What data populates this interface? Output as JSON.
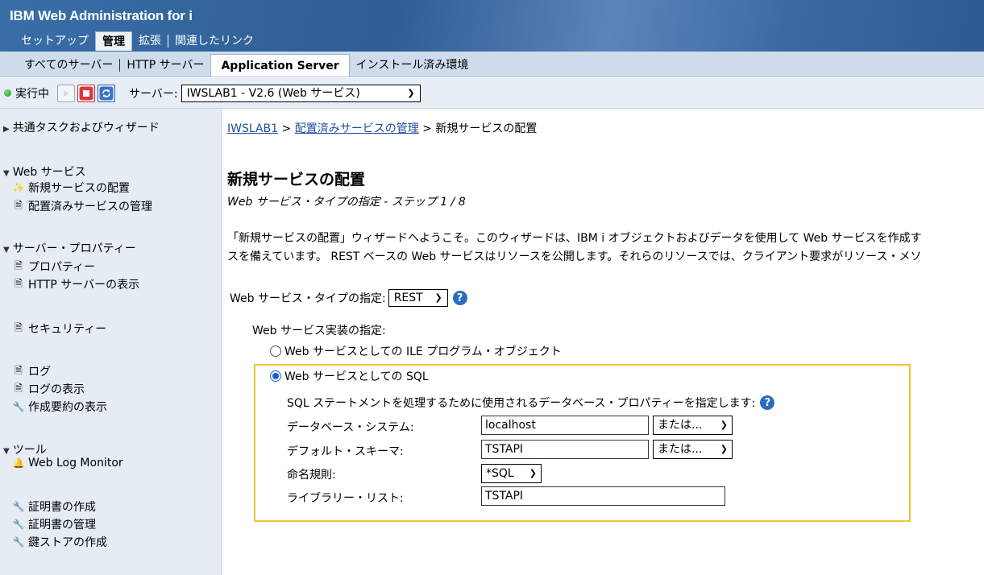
{
  "app": {
    "title": "IBM Web Administration for i"
  },
  "main_tabs": [
    {
      "label": "セットアップ"
    },
    {
      "label": "管理"
    },
    {
      "label": "拡張"
    },
    {
      "label": "関連したリンク"
    }
  ],
  "sub_tabs": [
    {
      "label": "すべてのサーバー"
    },
    {
      "label": "HTTP サーバー"
    },
    {
      "label": "Application Server"
    },
    {
      "label": "インストール済み環境"
    }
  ],
  "toolbar": {
    "status": "実行中",
    "server_label": "サーバー:",
    "server_value": "IWSLAB1 - V2.6 (Web サービス)",
    "status_color": "#1b8a1b",
    "stop_color": "#e0363d",
    "refresh_color": "#3a74c4"
  },
  "sidebar": {
    "common_tasks": "共通タスクおよびウィザード",
    "web_services": {
      "label": "Web サービス",
      "items": [
        {
          "label": "新規サービスの配置"
        },
        {
          "label": "配置済みサービスの管理"
        }
      ]
    },
    "server_props": {
      "label": "サーバー・プロパティー",
      "items": [
        {
          "label": "プロパティー"
        },
        {
          "label": "HTTP サーバーの表示"
        }
      ]
    },
    "security": "セキュリティー",
    "logs": [
      {
        "label": "ログ"
      },
      {
        "label": "ログの表示"
      },
      {
        "label": "作成要約の表示"
      }
    ],
    "tools": {
      "label": "ツール",
      "items": [
        {
          "label": "Web Log Monitor"
        }
      ]
    },
    "certs": [
      {
        "label": "証明書の作成"
      },
      {
        "label": "証明書の管理"
      },
      {
        "label": "鍵ストアの作成"
      }
    ]
  },
  "breadcrumb": {
    "link1": "IWSLAB1",
    "sep": " > ",
    "link2": "配置済みサービスの管理",
    "current": "新規サービスの配置"
  },
  "page": {
    "title": "新規サービスの配置",
    "step": "Web サービス・タイプの指定 - ステップ 1 / 8",
    "intro_line1": "「新規サービスの配置」ウィザードへようこそ。このウィザードは、IBM i オブジェクトおよびデータを使用して Web サービスを作成す",
    "intro_line2": "スを備えています。 REST ベースの Web サービスはリソースを公開します。それらのリソースでは、クライアント要求がリソース・メソ",
    "type_label": "Web サービス・タイプの指定:",
    "type_value": "REST",
    "impl_label": "Web サービス実装の指定:",
    "radio_ile": "Web サービスとしての ILE プログラム・オブジェクト",
    "radio_sql": "Web サービスとしての SQL",
    "sql_desc": "SQL ステートメントを処理するために使用されるデータベース・プロパティーを指定します:",
    "db_system_label": "データベース・システム:",
    "db_system_value": "localhost",
    "or_label": "または...",
    "schema_label": "デフォルト・スキーマ:",
    "schema_value": "TSTAPI",
    "naming_label": "命名規則:",
    "naming_value": "*SQL",
    "libl_label": "ライブラリー・リスト:",
    "libl_value": "TSTAPI",
    "highlight_color": "#f3c33b"
  }
}
